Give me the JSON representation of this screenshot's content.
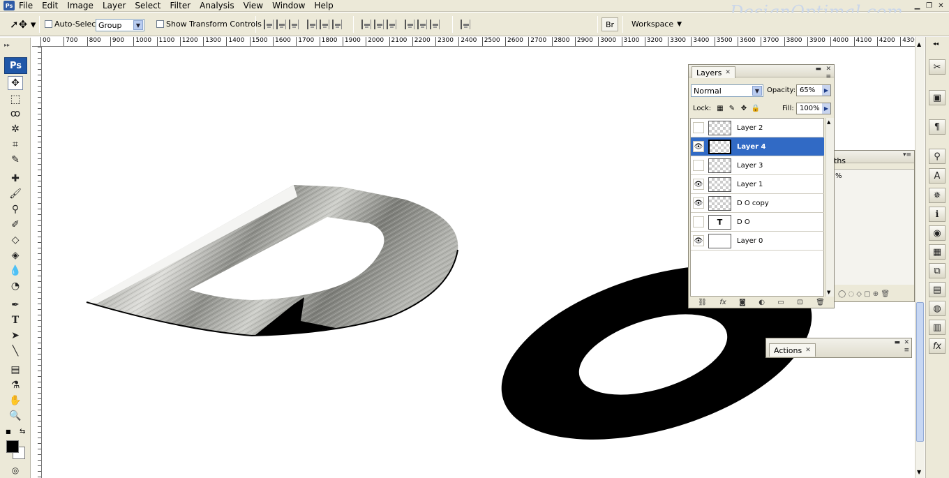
{
  "menubar": {
    "items": [
      "File",
      "Edit",
      "Image",
      "Layer",
      "Select",
      "Filter",
      "Analysis",
      "View",
      "Window",
      "Help"
    ],
    "watermark": "DesignOptimal.com"
  },
  "options": {
    "auto_select_label": "Auto-Select:",
    "auto_select_value": "Group",
    "show_transform_label": "Show Transform Controls",
    "workspace_label": "Workspace"
  },
  "toolbox": {
    "logo": "Ps"
  },
  "ruler": {
    "ticks": [
      "00",
      "700",
      "800",
      "900",
      "1000",
      "1100",
      "1200",
      "1300",
      "1400",
      "1500",
      "1600",
      "1700",
      "1800",
      "1900",
      "2000",
      "2100",
      "2200",
      "2300",
      "2400",
      "2500",
      "2600",
      "2700",
      "2800",
      "2900",
      "3000",
      "3100",
      "3200",
      "3300",
      "3400",
      "3500",
      "3600",
      "3700",
      "3800",
      "3900",
      "4000",
      "4100",
      "4200",
      "4300"
    ]
  },
  "layers_panel": {
    "tab_label": "Layers",
    "blend_mode": "Normal",
    "opacity_label": "Opacity:",
    "opacity_value": "65%",
    "lock_label": "Lock:",
    "fill_label": "Fill:",
    "fill_value": "100%",
    "layers": [
      {
        "name": "Layer 2",
        "visible": false,
        "selected": false,
        "thumb": ""
      },
      {
        "name": "Layer 4",
        "visible": true,
        "selected": true,
        "thumb": ""
      },
      {
        "name": "Layer 3",
        "visible": false,
        "selected": false,
        "thumb": ""
      },
      {
        "name": "Layer 1",
        "visible": true,
        "selected": false,
        "thumb": ""
      },
      {
        "name": "D O copy",
        "visible": true,
        "selected": false,
        "thumb": ""
      },
      {
        "name": "D O",
        "visible": false,
        "selected": false,
        "thumb": "T"
      },
      {
        "name": "Layer 0",
        "visible": true,
        "selected": false,
        "thumb": ""
      }
    ]
  },
  "paths_panel": {
    "tab_label": "ths",
    "value": "%"
  },
  "actions_panel": {
    "tab_label": "Actions"
  }
}
